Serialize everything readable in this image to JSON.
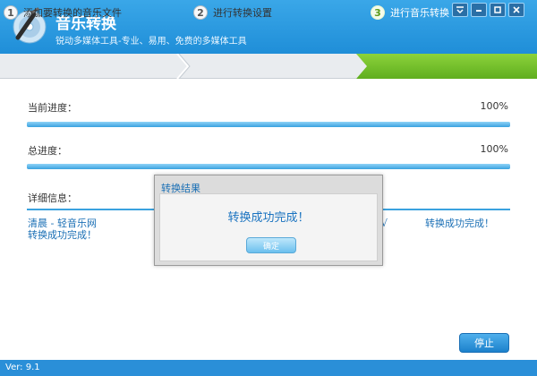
{
  "header": {
    "title": "音乐转换",
    "subtitle": "锐动多媒体工具-专业、易用、免费的多媒体工具"
  },
  "window_controls": [
    "menu-icon",
    "minimize-icon",
    "maximize-icon",
    "close-icon"
  ],
  "steps": [
    {
      "num": "1",
      "label": "添加要转换的音乐文件"
    },
    {
      "num": "2",
      "label": "进行转换设置"
    },
    {
      "num": "3",
      "label": "进行音乐转换"
    }
  ],
  "progress": {
    "current_label": "当前进度：",
    "current_value": "100%",
    "total_label": "总进度：",
    "total_value": "100%",
    "current_fraction": 1.0,
    "total_fraction": 1.0
  },
  "details": {
    "label": "详细信息：",
    "file_name": "清晨 - 轻音乐网",
    "file_status": "转换成功完成！",
    "right_status": "转换成功完成！",
    "fragment": "√"
  },
  "dialog": {
    "title": "转换结果",
    "message": "转换成功完成！",
    "ok_label": "确定"
  },
  "stop_label": "停止",
  "version": "Ver: 9.1",
  "colors": {
    "accent": "#1f8ed8",
    "active_step": "#6ebf25"
  }
}
